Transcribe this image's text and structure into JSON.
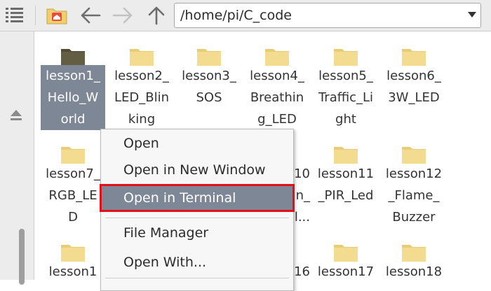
{
  "toolbar": {
    "path": "/home/pi/C_code",
    "icons": [
      "view-list-icon",
      "home-icon",
      "back-arrow-icon",
      "forward-arrow-icon",
      "up-arrow-icon",
      "chevron-down-icon"
    ]
  },
  "folders": [
    {
      "label": "lesson1_\nHello_W\norld",
      "selected": true
    },
    {
      "label": "lesson2_\nLED_Blin\nking"
    },
    {
      "label": "lesson3_\nSOS"
    },
    {
      "label": "lesson4_\nBreathin\ng_LED"
    },
    {
      "label": "lesson5_\nTraffic_Li\nght"
    },
    {
      "label": "lesson6_\n3W_LED"
    },
    {
      "label": "lesson7_\nRGB_LE\nD"
    },
    {
      "label": "10\nn_\nll..."
    },
    {
      "label": "lesson11\n_PIR_Led"
    },
    {
      "label": "lesson12\n_Flame_\nBuzzer"
    },
    {
      "label": "lesson1"
    },
    {
      "label": "16"
    },
    {
      "label": "lesson17"
    },
    {
      "label": "lesson18"
    }
  ],
  "context_menu": {
    "open": "Open",
    "open_new_window": "Open in New Window",
    "open_terminal": "Open in Terminal",
    "file_manager": "File Manager",
    "open_with": "Open With..."
  },
  "colors": {
    "selection": "#7d8795",
    "highlight_box": "#e3101b",
    "folder": "#f3dc8f"
  }
}
